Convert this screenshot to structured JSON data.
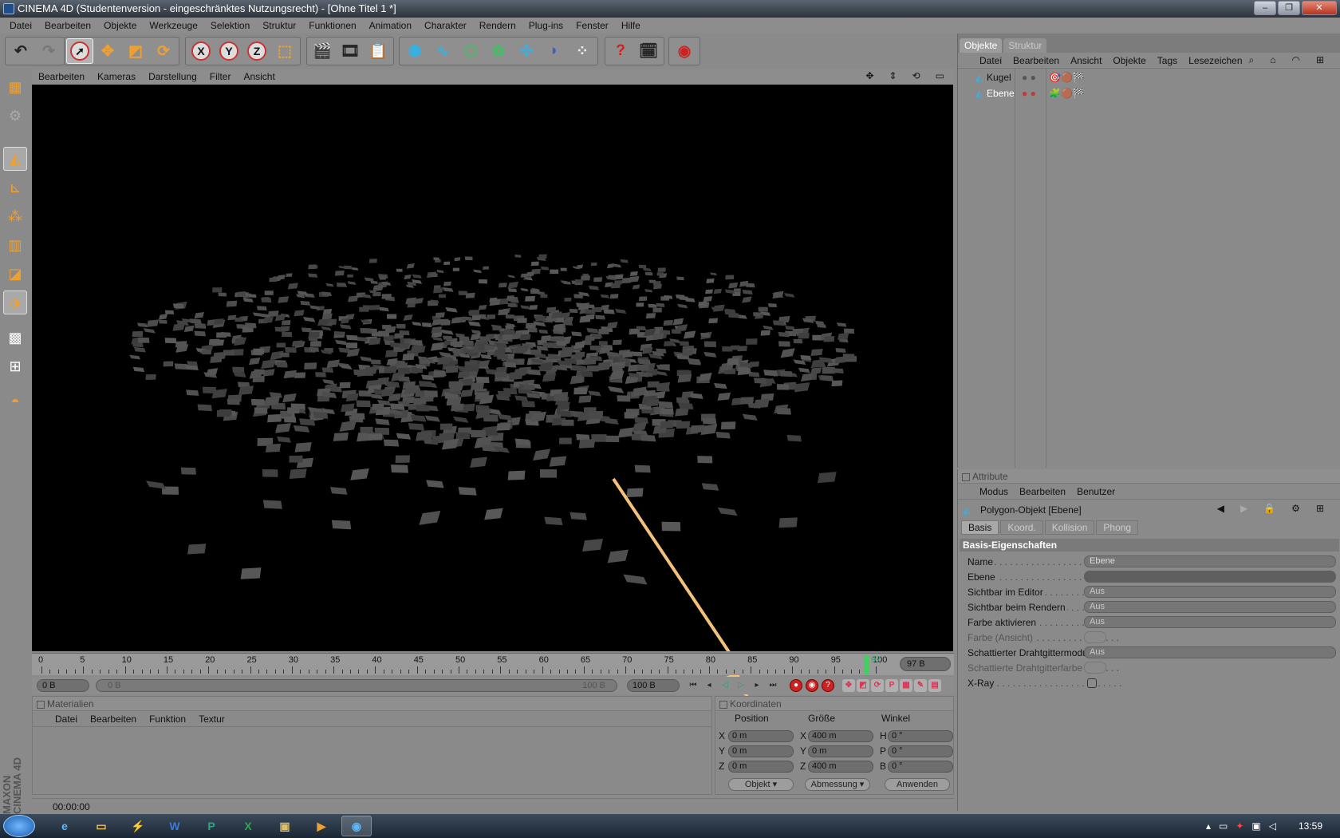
{
  "window": {
    "title": "CINEMA 4D (Studentenversion - eingeschränktes Nutzungsrecht) - [Ohne Titel 1 *]"
  },
  "menubar": [
    "Datei",
    "Bearbeiten",
    "Objekte",
    "Werkzeuge",
    "Selektion",
    "Struktur",
    "Funktionen",
    "Animation",
    "Charakter",
    "Rendern",
    "Plug-ins",
    "Fenster",
    "Hilfe"
  ],
  "toolbar": {
    "coord_x": "X",
    "coord_y": "Y",
    "coord_z": "Z"
  },
  "viewport": {
    "menu": [
      "Bearbeiten",
      "Kameras",
      "Darstellung",
      "Filter",
      "Ansicht"
    ]
  },
  "timeline": {
    "frames": [
      "0",
      "5",
      "10",
      "15",
      "20",
      "25",
      "30",
      "35",
      "40",
      "45",
      "50",
      "55",
      "60",
      "65",
      "70",
      "75",
      "80",
      "85",
      "90",
      "95",
      "97",
      "100"
    ],
    "current_frame": "97 B",
    "start_field": "0 B",
    "range_start": "0 B",
    "range_end": "100 B",
    "end_field": "100 B"
  },
  "materials": {
    "title": "Materialien",
    "menu": [
      "Datei",
      "Bearbeiten",
      "Funktion",
      "Textur"
    ]
  },
  "coordinates": {
    "title": "Koordinaten",
    "col_position": "Position",
    "col_size": "Größe",
    "col_angle": "Winkel",
    "rows": [
      {
        "axis": "X",
        "pos": "0 m",
        "size_axis": "X",
        "size": "400 m",
        "angle_axis": "H",
        "angle": "0 °"
      },
      {
        "axis": "Y",
        "pos": "0 m",
        "size_axis": "Y",
        "size": "0 m",
        "angle_axis": "P",
        "angle": "0 °"
      },
      {
        "axis": "Z",
        "pos": "0 m",
        "size_axis": "Z",
        "size": "400 m",
        "angle_axis": "B",
        "angle": "0 °"
      }
    ],
    "mode": "Objekt",
    "dimension": "Abmessung",
    "apply": "Anwenden"
  },
  "statusbar": {
    "time": "00:00:00"
  },
  "objects_panel": {
    "tabs": [
      "Objekte",
      "Struktur"
    ],
    "menu": [
      "Datei",
      "Bearbeiten",
      "Ansicht",
      "Objekte",
      "Tags",
      "Lesezeichen"
    ],
    "items": [
      {
        "name": "Kugel"
      },
      {
        "name": "Ebene"
      }
    ]
  },
  "attributes": {
    "title": "Attribute",
    "menu": [
      "Modus",
      "Bearbeiten",
      "Benutzer"
    ],
    "object_label": "Polygon-Objekt [Ebene]",
    "tabs": [
      "Basis",
      "Koord.",
      "Kollision",
      "Phong"
    ],
    "section": "Basis-Eigenschaften",
    "fields": [
      {
        "label": "Name",
        "value": "Ebene"
      },
      {
        "label": "Ebene",
        "value": ""
      },
      {
        "label": "Sichtbar im Editor",
        "value": "Aus"
      },
      {
        "label": "Sichtbar beim Rendern",
        "value": "Aus"
      },
      {
        "label": "Farbe aktivieren",
        "value": "Aus"
      },
      {
        "label": "Farbe (Ansicht)",
        "value": ""
      },
      {
        "label": "Schattierter Drahtgittermodus",
        "value": "Aus"
      },
      {
        "label": "Schattierte Drahtgitterfarbe",
        "value": ""
      },
      {
        "label": "X-Ray",
        "value": ""
      }
    ]
  },
  "taskbar": {
    "clock": "13:59"
  },
  "branding": {
    "logo": "MAXON CINEMA 4D"
  },
  "colors": {
    "accent_arrow": "#f3c27a",
    "playhead": "#40d060",
    "viewport_bg": "#000000"
  }
}
